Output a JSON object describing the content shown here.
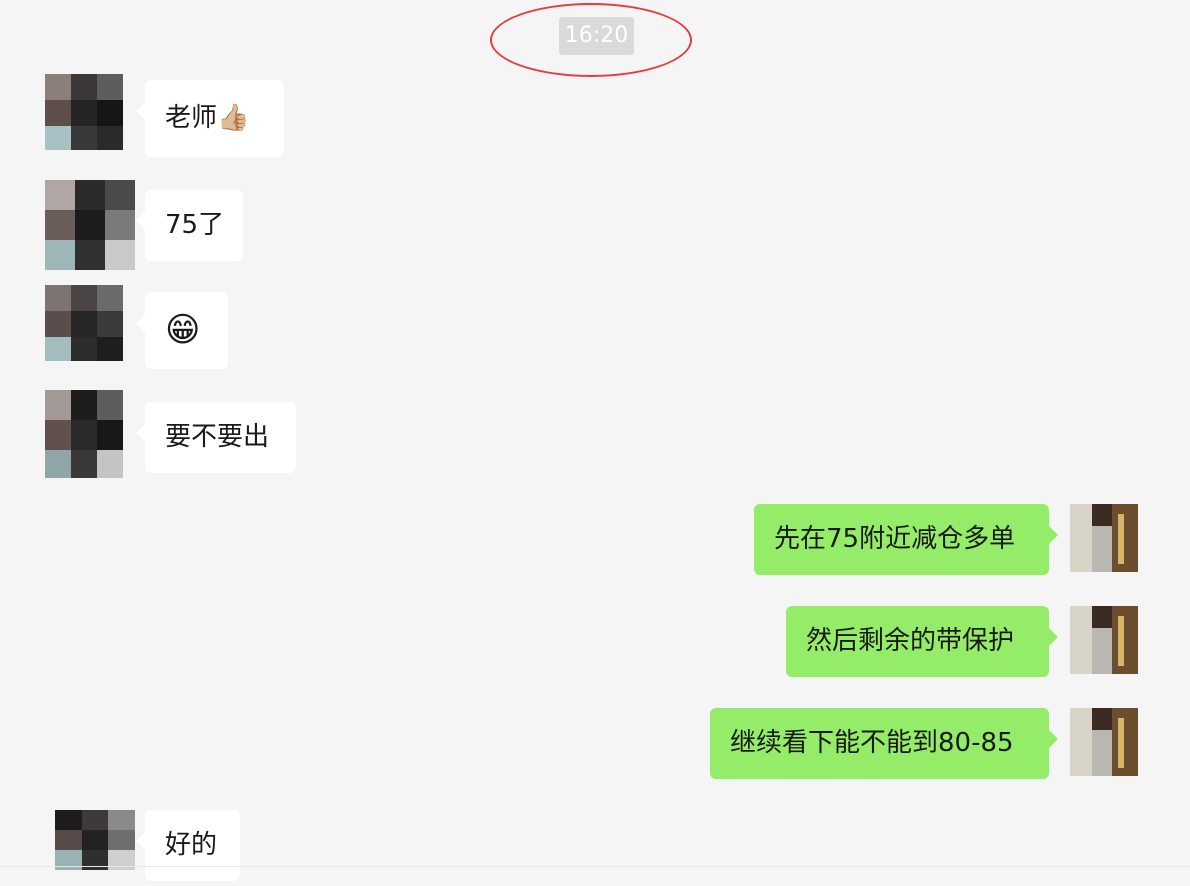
{
  "chat": {
    "timestamp": "16:20",
    "messages": [
      {
        "side": "in",
        "text": "老师👍🏼"
      },
      {
        "side": "in",
        "text": "75了"
      },
      {
        "side": "in",
        "text": "😁"
      },
      {
        "side": "in",
        "text": "要不要出"
      },
      {
        "side": "out",
        "text": "先在75附近减仓多单"
      },
      {
        "side": "out",
        "text": "然后剩余的带保护"
      },
      {
        "side": "out",
        "text": "继续看下能不能到80-85"
      },
      {
        "side": "in",
        "text": "好的"
      }
    ]
  },
  "colors": {
    "background": "#f5f5f5",
    "incoming_bubble": "#ffffff",
    "outgoing_bubble": "#95ec69",
    "timestamp_badge": "#dadada",
    "annotation_circle": "#e8393d"
  }
}
